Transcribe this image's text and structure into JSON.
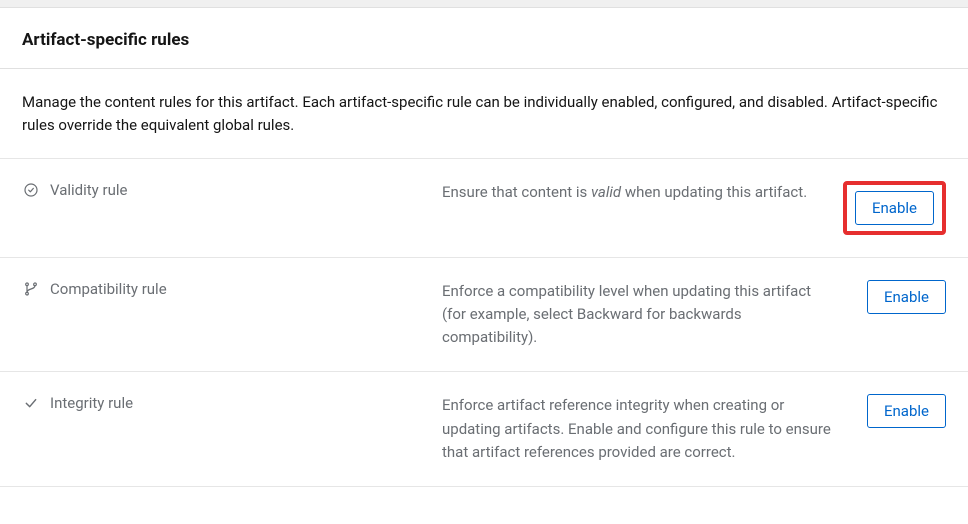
{
  "header": {
    "title": "Artifact-specific rules"
  },
  "description": "Manage the content rules for this artifact. Each artifact-specific rule can be individually enabled, configured, and disabled. Artifact-specific rules override the equivalent global rules.",
  "rules": [
    {
      "name": "Validity rule",
      "desc_pre": "Ensure that content is ",
      "desc_em": "valid",
      "desc_post": " when updating this artifact.",
      "button": "Enable",
      "highlighted": true
    },
    {
      "name": "Compatibility rule",
      "desc_full": "Enforce a compatibility level when updating this artifact (for example, select Backward for backwards compatibility).",
      "button": "Enable",
      "highlighted": false
    },
    {
      "name": "Integrity rule",
      "desc_full": "Enforce artifact reference integrity when creating or updating artifacts. Enable and configure this rule to ensure that artifact references provided are correct.",
      "button": "Enable",
      "highlighted": false
    }
  ]
}
